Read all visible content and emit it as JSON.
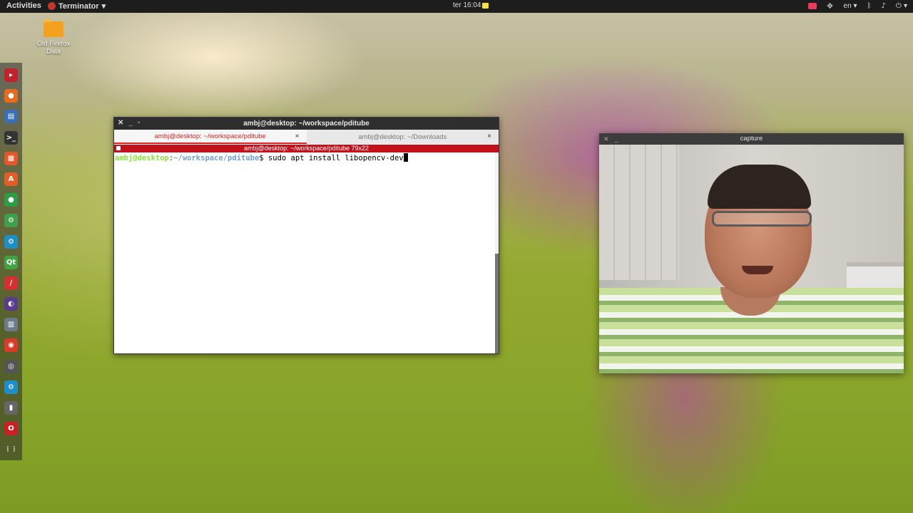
{
  "topbar": {
    "activities": "Activities",
    "app_name": "Terminator",
    "app_menu_arrow": "▾",
    "clock": "ter 16:04",
    "language": "en",
    "language_arrow": "▾",
    "power_arrow": "▾"
  },
  "desktop": {
    "icon_label_line1": "Old Firefox",
    "icon_label_line2": "Data"
  },
  "dock": {
    "items": [
      {
        "name": "terminator",
        "color": "#c0232c",
        "glyph": "▸"
      },
      {
        "name": "firefox",
        "color": "#e66b1f",
        "glyph": "●"
      },
      {
        "name": "files",
        "color": "#3b6fb5",
        "glyph": "▤"
      },
      {
        "name": "terminal",
        "color": "#333333",
        "glyph": ">_"
      },
      {
        "name": "office",
        "color": "#e2572b",
        "glyph": "▦"
      },
      {
        "name": "software-center",
        "color": "#e05f26",
        "glyph": "A"
      },
      {
        "name": "app-green",
        "color": "#2e9e44",
        "glyph": "●"
      },
      {
        "name": "settings-green",
        "color": "#3f9f4a",
        "glyph": "⚙"
      },
      {
        "name": "settings-blue",
        "color": "#1e8fc6",
        "glyph": "⚙"
      },
      {
        "name": "qt-creator",
        "color": "#41a244",
        "glyph": "Qt"
      },
      {
        "name": "inkscape",
        "color": "#d33030",
        "glyph": "∕"
      },
      {
        "name": "eclipse",
        "color": "#5a3c8c",
        "glyph": "◐"
      },
      {
        "name": "trash",
        "color": "#6b7b8a",
        "glyph": "▥"
      },
      {
        "name": "chrome",
        "color": "#db3a2a",
        "glyph": "◉"
      },
      {
        "name": "webcam",
        "color": "#555555",
        "glyph": "◎"
      },
      {
        "name": "gear",
        "color": "#1e8fc6",
        "glyph": "⚙"
      },
      {
        "name": "usb",
        "color": "#666666",
        "glyph": "▮"
      },
      {
        "name": "opera",
        "color": "#cc1f24",
        "glyph": "O"
      },
      {
        "name": "show-apps",
        "color": "transparent",
        "glyph": "⋮⋮"
      }
    ]
  },
  "terminal": {
    "title": "ambj@desktop: ~/workspace/pditube",
    "tabs": [
      {
        "label": "ambj@desktop: ~/workspace/pditube",
        "close": "×"
      },
      {
        "label": "ambj@desktop: ~/Downloads",
        "close": "×"
      }
    ],
    "info": "ambj@desktop: ~/workspace/pditube 79x22",
    "prompt_user": "ambj@desktop",
    "prompt_colon": ":",
    "prompt_path": "~/workspace/pditube",
    "prompt_symbol": "$ ",
    "command": "sudo apt install libopencv-dev"
  },
  "capture": {
    "title": "capture"
  }
}
